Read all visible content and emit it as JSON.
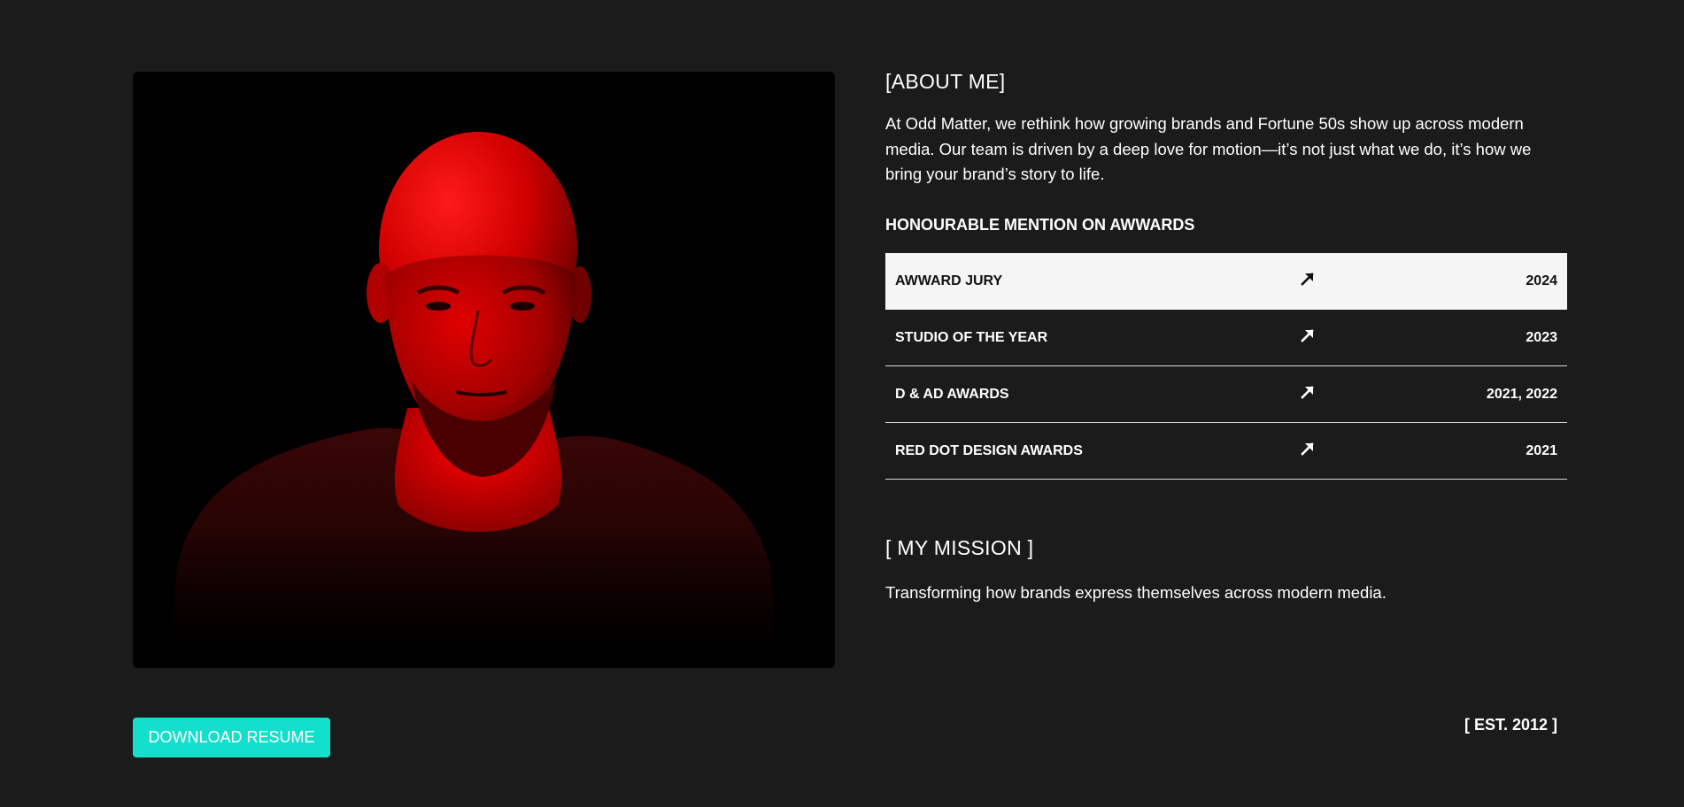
{
  "photo": {
    "icon": "portrait-photo",
    "tint_color": "#e00000"
  },
  "about": {
    "title": "[ABOUT ME]",
    "text": "At Odd Matter, we rethink how growing brands and Fortune 50s show up across modern media. Our team is driven by a deep love for motion—it’s not just what we do, it’s how we bring your brand’s story to life."
  },
  "awards": {
    "heading": "HONOURABLE MENTION ON AWWARDS",
    "items": [
      {
        "name": "AWWARD JURY",
        "year": "2024",
        "icon": "arrow-up-right-icon",
        "active": true
      },
      {
        "name": "STUDIO OF THE YEAR",
        "year": "2023",
        "icon": "arrow-up-right-icon",
        "active": false
      },
      {
        "name": "D & AD AWARDS",
        "year": "2021, 2022",
        "icon": "arrow-up-right-icon",
        "active": false
      },
      {
        "name": "RED DOT DESIGN AWARDS",
        "year": "2021",
        "icon": "arrow-up-right-icon",
        "active": false
      }
    ]
  },
  "mission": {
    "title": "[ MY MISSION ]",
    "text": "Transforming how brands express themselves across modern media."
  },
  "download_button": {
    "label": "DOWNLOAD RESUME",
    "color": "#13e0cc"
  },
  "est": {
    "label": "[ EST. 2012 ]"
  },
  "colors": {
    "background": "#1b1b1b",
    "text": "#ffffff",
    "active_row_bg": "#f5f5f5"
  }
}
